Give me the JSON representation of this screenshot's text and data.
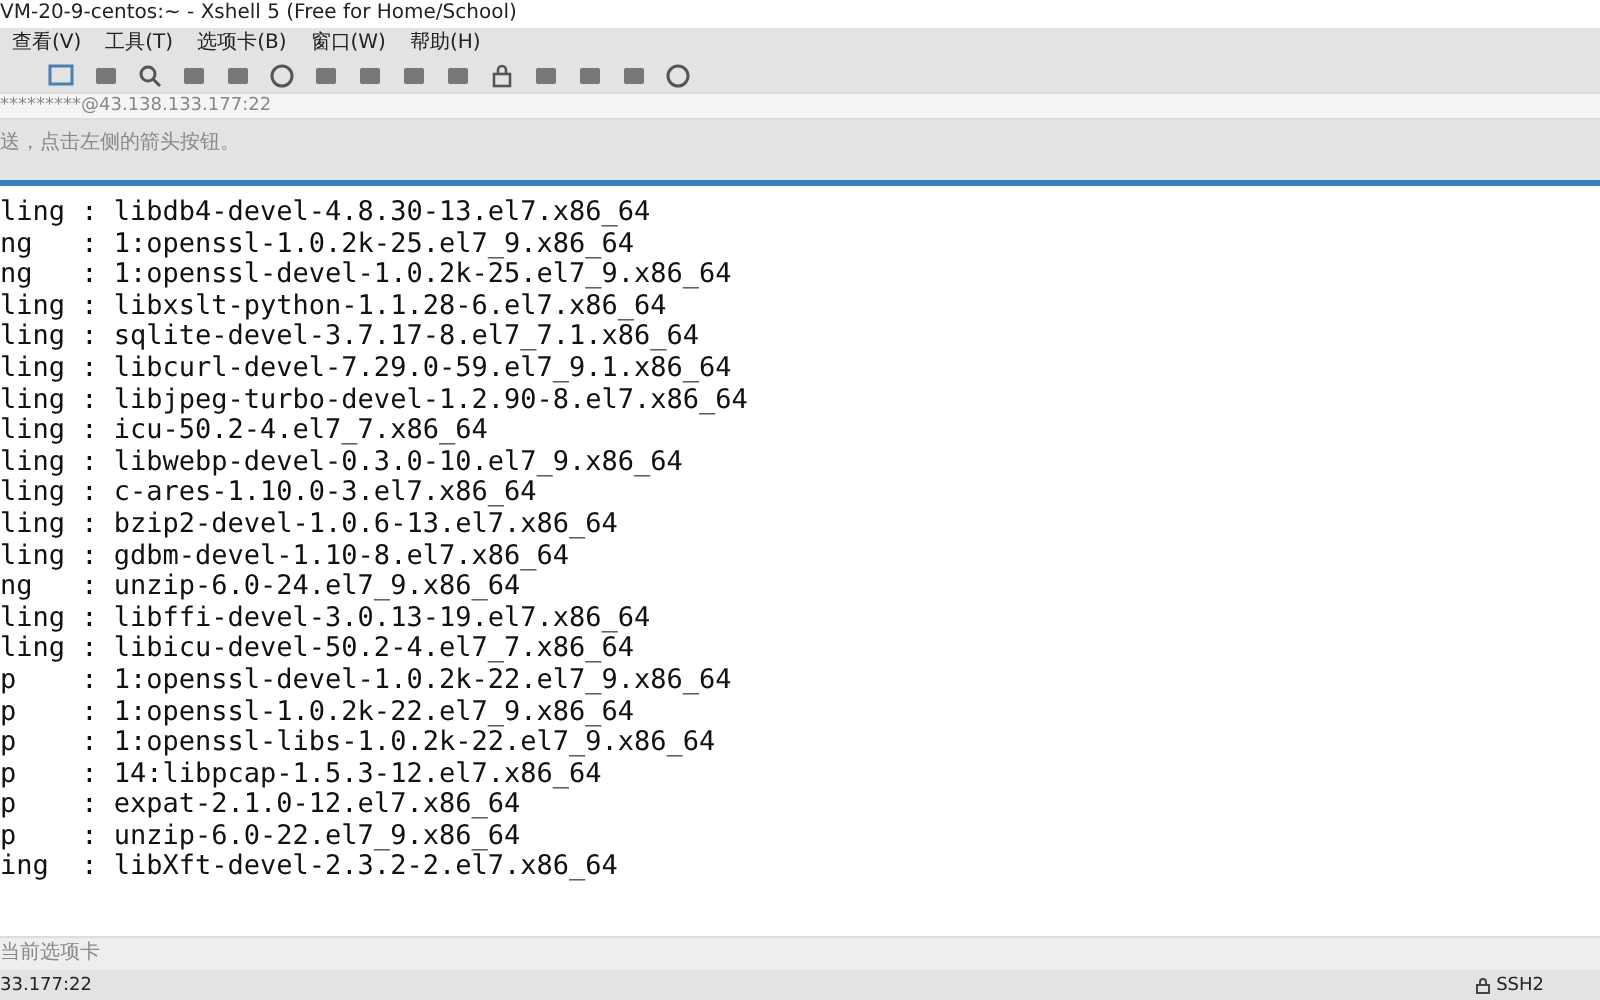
{
  "window": {
    "title": "VM-20-9-centos:~ - Xshell 5 (Free for Home/School)"
  },
  "menu": [
    "查看(V)",
    "工具(T)",
    "选项卡(B)",
    "窗口(W)",
    "帮助(H)"
  ],
  "address": "*********@43.138.133.177:22",
  "hint": "送，点击左侧的箭头按钮。",
  "terminal_lines": [
    "ling : libdb4-devel-4.8.30-13.el7.x86_64",
    "ng   : 1:openssl-1.0.2k-25.el7_9.x86_64",
    "ng   : 1:openssl-devel-1.0.2k-25.el7_9.x86_64",
    "ling : libxslt-python-1.1.28-6.el7.x86_64",
    "ling : sqlite-devel-3.7.17-8.el7_7.1.x86_64",
    "ling : libcurl-devel-7.29.0-59.el7_9.1.x86_64",
    "ling : libjpeg-turbo-devel-1.2.90-8.el7.x86_64",
    "ling : icu-50.2-4.el7_7.x86_64",
    "ling : libwebp-devel-0.3.0-10.el7_9.x86_64",
    "ling : c-ares-1.10.0-3.el7.x86_64",
    "ling : bzip2-devel-1.0.6-13.el7.x86_64",
    "ling : gdbm-devel-1.10-8.el7.x86_64",
    "ng   : unzip-6.0-24.el7_9.x86_64",
    "ling : libffi-devel-3.0.13-19.el7.x86_64",
    "ling : libicu-devel-50.2-4.el7_7.x86_64",
    "p    : 1:openssl-devel-1.0.2k-22.el7_9.x86_64",
    "p    : 1:openssl-1.0.2k-22.el7_9.x86_64",
    "p    : 1:openssl-libs-1.0.2k-22.el7_9.x86_64",
    "p    : 14:libpcap-1.5.3-12.el7.x86_64",
    "p    : expat-2.1.0-12.el7.x86_64",
    "p    : unzip-6.0-22.el7_9.x86_64",
    "ing  : libXft-devel-2.3.2-2.el7.x86_64"
  ],
  "tab_hint": "当前选项卡",
  "status_bar": {
    "address": "33.177:22",
    "protocol": "SSH2"
  }
}
